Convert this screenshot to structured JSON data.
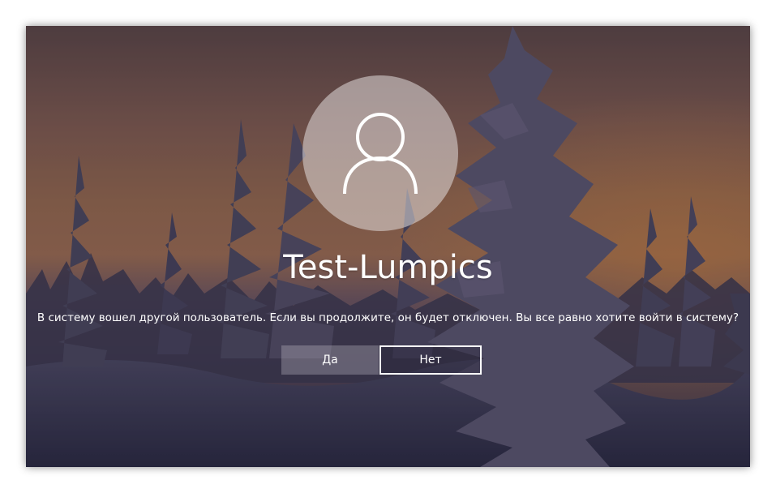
{
  "login": {
    "username": "Test-Lumpics",
    "message": "В систему вошел другой пользователь. Если вы продолжите, он будет отключен. Вы все равно хотите войти в систему?",
    "buttons": {
      "yes_label": "Да",
      "no_label": "Нет"
    },
    "avatar_icon": "user-icon"
  },
  "colors": {
    "text": "#ffffff",
    "focus_border": "#ffffff"
  }
}
